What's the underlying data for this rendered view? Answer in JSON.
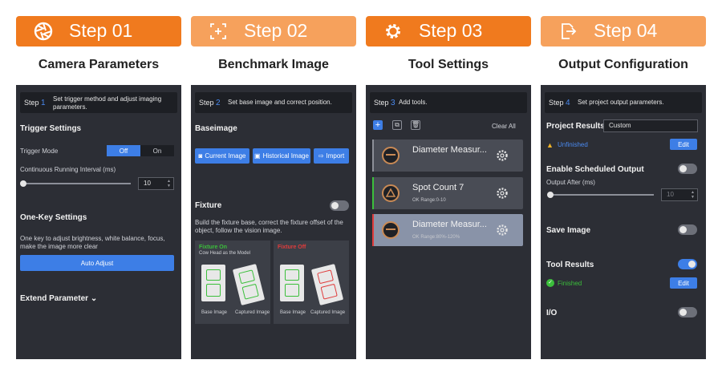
{
  "steps": [
    {
      "title": "Step 01",
      "subtitle": "Camera Parameters",
      "icon": "aperture-icon"
    },
    {
      "title": "Step 02",
      "subtitle": "Benchmark Image",
      "icon": "crosshair-icon"
    },
    {
      "title": "Step 03",
      "subtitle": "Tool Settings",
      "icon": "gear-icon"
    },
    {
      "title": "Step 04",
      "subtitle": "Output Configuration",
      "icon": "export-icon"
    }
  ],
  "panel1": {
    "step_label": "Step",
    "step_num": "1",
    "step_desc": "Set trigger method and adjust imaging parameters.",
    "trigger_heading": "Trigger Settings",
    "trigger_mode_label": "Trigger Mode",
    "trigger_off": "Off",
    "trigger_on": "On",
    "interval_label": "Continuous Running Interval (ms)",
    "interval_value": "10",
    "onekey_heading": "One-Key Settings",
    "onekey_desc": "One key to adjust brightness, white balance, focus, make the image more clear",
    "auto_adjust": "Auto Adjust",
    "extend": "Extend Parameter"
  },
  "panel2": {
    "step_label": "Step",
    "step_num": "2",
    "step_desc": "Set base image and correct position.",
    "baseimage_heading": "Baseimage",
    "btn_current": "Current Image",
    "btn_historical": "Historical Image",
    "btn_import": "Import",
    "fixture_heading": "Fixture",
    "fixture_desc": "Build the fixture base, correct the fixture offset of the object, follow the vision image.",
    "fix_on_title": "Fixture On",
    "fix_on_sub": "Cow Head as the Model",
    "fix_off_title": "Fixture Off",
    "cap_base": "Base Image",
    "cap_captured": "Captured Image"
  },
  "panel3": {
    "step_label": "Step",
    "step_num": "3",
    "step_desc": "Add tools.",
    "clear_all": "Clear All",
    "tools": [
      {
        "name": "Diameter Measur...",
        "range": ""
      },
      {
        "name": "Spot Count 7",
        "range": "OK Range:0-10"
      },
      {
        "name": "Diameter Measur...",
        "range": "OK Range:80%-120%"
      }
    ]
  },
  "panel4": {
    "step_label": "Step",
    "step_num": "4",
    "step_desc": "Set project output parameters.",
    "project_results": "Project Results",
    "project_value": "Custom",
    "unfinished": "Unfinished",
    "edit": "Edit",
    "scheduled": "Enable Scheduled Output",
    "output_after": "Output After (ms)",
    "output_value": "10",
    "save_image": "Save Image",
    "tool_results": "Tool Results",
    "finished": "Finished",
    "io": "I/O"
  },
  "colors": {
    "accent": "#f07a1e",
    "accent_light": "#f6a15c",
    "panel": "#2c2e35",
    "blue": "#3d7ee6",
    "green": "#3bbf3b",
    "red": "#e03c3c"
  }
}
